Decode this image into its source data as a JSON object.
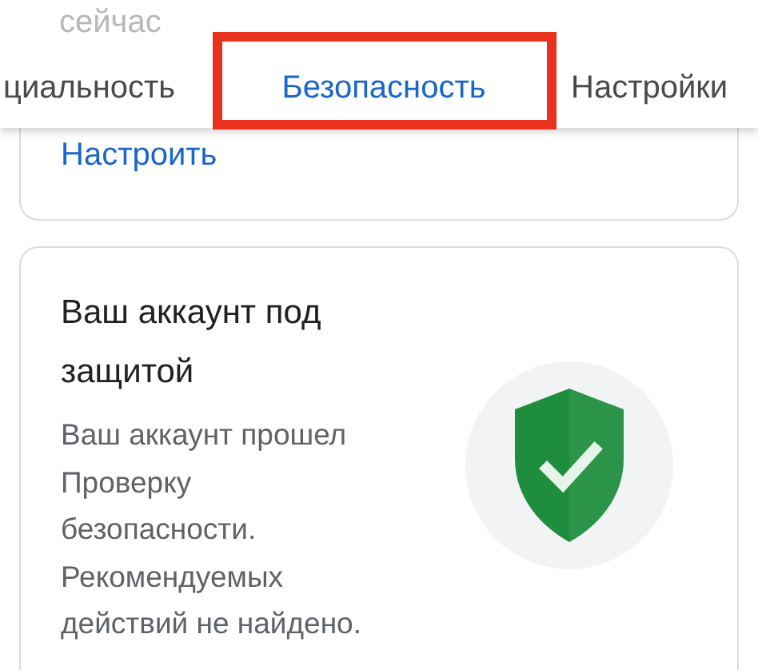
{
  "header_partial_text": "сейчас",
  "tabs": [
    {
      "label": "циальность",
      "selected": false,
      "highlighted": false
    },
    {
      "label": "Безопасность",
      "selected": true,
      "highlighted": true
    },
    {
      "label": "Настройки",
      "selected": false,
      "highlighted": false
    }
  ],
  "previous_card": {
    "link": "Настроить"
  },
  "status_card": {
    "title": "Ваш аккаунт под защитой",
    "body": "Ваш аккаунт прошел Проверку безопасности. Рекомендуемых действий не найдено.",
    "verified": true
  }
}
